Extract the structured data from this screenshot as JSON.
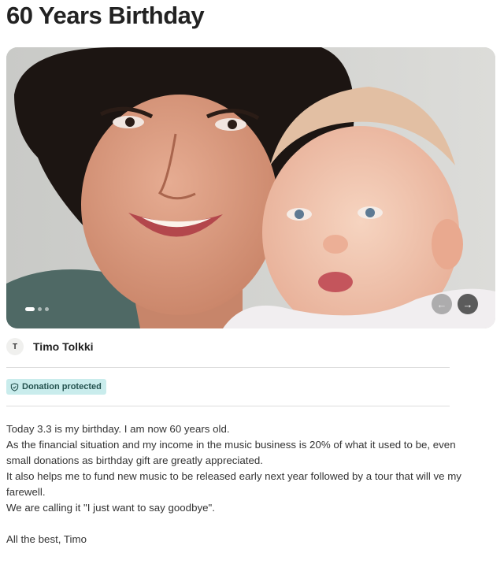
{
  "campaign": {
    "title": "60 Years Birthday"
  },
  "hero": {
    "image_alt": "Photo of a smiling woman holding a baby",
    "slide_count": 3,
    "active_slide": 1,
    "prev_icon": "arrow-left-icon",
    "next_icon": "arrow-right-icon"
  },
  "organizer": {
    "initial": "T",
    "name": "Timo Tolkki"
  },
  "badge": {
    "icon": "shield-icon",
    "label": "Donation protected",
    "color": "#c9ecec"
  },
  "story": {
    "lines": [
      "Today 3.3 is my birthday. I am now 60 years old.",
      "As the financial situation and my income in the music business is 20% of what it used to be, even small donations as birthday gift are greatly appreciated.",
      "It also helps me to fund new music to be released early next year followed by a tour that will ve my farewell.",
      "We are calling it \"I just want to say goodbye\"."
    ],
    "signoff": "All the best, Timo"
  }
}
